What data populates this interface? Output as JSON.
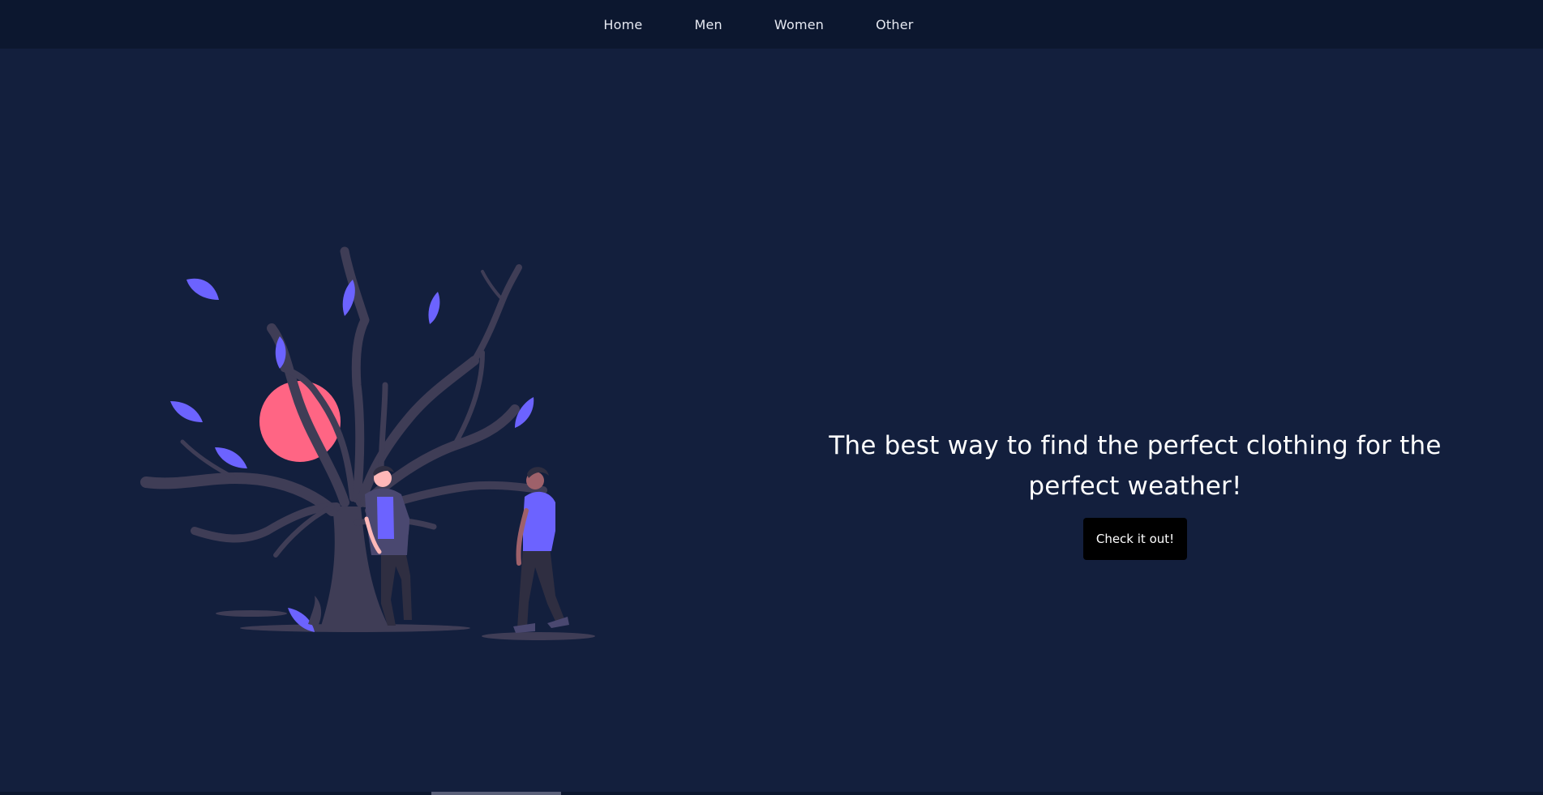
{
  "nav": {
    "items": [
      {
        "label": "Home"
      },
      {
        "label": "Men"
      },
      {
        "label": "Women"
      },
      {
        "label": "Other"
      }
    ]
  },
  "hero": {
    "heading": "The best way to find the perfect clothing for the perfect weather!",
    "button_label": "Check it out!"
  },
  "colors": {
    "page_background": "#131f3d",
    "navbar_background": "#0c172f",
    "button_background": "#000000",
    "text": "#ffffff",
    "leaf": "#6c63ff",
    "sun": "#ff6584",
    "tree": "#3f3d56"
  },
  "illustration": {
    "icon": "tree-people-illustration"
  }
}
